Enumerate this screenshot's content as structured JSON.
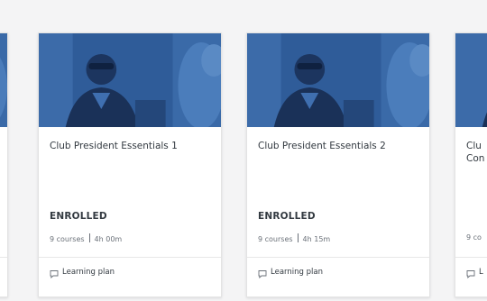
{
  "cards": [
    {
      "title": "",
      "status": "",
      "courses": "",
      "duration": "",
      "type_label": "",
      "image_icon": "photo-woman-presenting"
    },
    {
      "title": "Club President Essentials 1",
      "status": "ENROLLED",
      "courses": "9 courses",
      "duration": "4h 00m",
      "type_label": "Learning plan",
      "image_icon": "photo-woman-presenting"
    },
    {
      "title": "Club President Essentials 2",
      "status": "ENROLLED",
      "courses": "9 courses",
      "duration": "4h 15m",
      "type_label": "Learning plan",
      "image_icon": "photo-woman-presenting"
    },
    {
      "title": "Clu Con",
      "status": "",
      "courses": "9 co",
      "duration": "",
      "type_label": "L",
      "image_icon": "photo-woman-presenting"
    }
  ],
  "colors": {
    "page_background": "#f4f4f5",
    "card_background": "#ffffff",
    "image_tint": "#2f5c99",
    "text_primary": "#333a41",
    "text_secondary": "#6a7078"
  }
}
